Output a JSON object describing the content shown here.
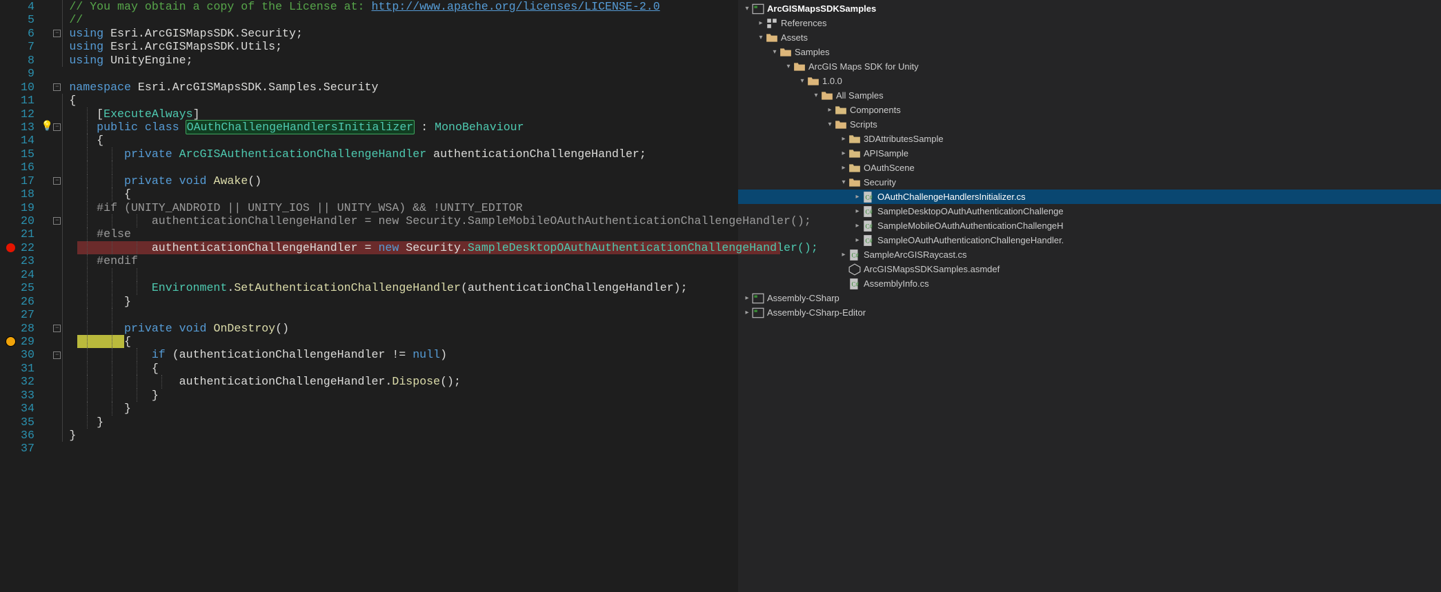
{
  "editor": {
    "lineNumbers": [
      "4",
      "5",
      "6",
      "7",
      "8",
      "9",
      "10",
      "11",
      "12",
      "13",
      "14",
      "15",
      "16",
      "17",
      "18",
      "19",
      "20",
      "21",
      "22",
      "23",
      "24",
      "25",
      "26",
      "27",
      "28",
      "29",
      "30",
      "31",
      "32",
      "33",
      "34",
      "35",
      "36",
      "37"
    ],
    "breakpoints": {
      "22": "red",
      "29": "orange"
    },
    "bulbLine": "13",
    "foldBoxes": {
      "6": "-",
      "10": "-",
      "13": "-",
      "17": "-",
      "20": "-",
      "28": "-",
      "30": "-"
    },
    "highlightedClass": "OAuthChallengeHandlersInitializer",
    "tokens": {
      "comment_license": "// You may obtain a copy of the License at: ",
      "license_url": "http://www.apache.org/licenses/LICENSE-2.0",
      "comment_slash": "//",
      "using": "using",
      "ns_security": "Esri.ArcGISMapsSDK.Security;",
      "ns_utils": "Esri.ArcGISMapsSDK.Utils;",
      "ns_unity": "UnityEngine;",
      "namespace": "namespace",
      "ns_full": "Esri.ArcGISMapsSDK.Samples.Security",
      "brace_open": "{",
      "brace_close": "}",
      "attr_open": "[",
      "attr_close": "]",
      "ExecuteAlways": "ExecuteAlways",
      "public": "public",
      "class": "class",
      "colon": " : ",
      "MonoBehaviour": "MonoBehaviour",
      "private": "private",
      "ArcGISAuthChallengeHandler": "ArcGISAuthenticationChallengeHandler",
      "field_name": "authenticationChallengeHandler;",
      "void": "void",
      "Awake": "Awake",
      "parens": "()",
      "pre_if": "#if (UNITY_ANDROID || UNITY_IOS || UNITY_WSA) && !UNITY_EDITOR",
      "pre_else": "#else",
      "pre_endif": "#endif",
      "assign_mobile": "authenticationChallengeHandler = ",
      "new": "new",
      "sec_ns": "Security",
      "dot": ".",
      "mobile_ctor": "SampleMobileOAuthAuthenticationChallengeHandler();",
      "desktop_ctor": "SampleDesktopOAuthAuthenticationChallengeHandler();",
      "Environment": "Environment",
      "SetAuth": "SetAuthenticationChallengeHandler",
      "arg": "(authenticationChallengeHandler);",
      "OnDestroy": "OnDestroy",
      "if": "if",
      "cond": " (authenticationChallengeHandler != ",
      "null": "null",
      "cond_close": ")",
      "dispose": "authenticationChallengeHandler.",
      "DisposeM": "Dispose",
      "dispose_end": "();"
    }
  },
  "solution": {
    "project": "ArcGISMapsSDKSamples",
    "nodes": {
      "references": "References",
      "assets": "Assets",
      "samples": "Samples",
      "sdk": "ArcGIS Maps SDK for Unity",
      "ver": "1.0.0",
      "allsamples": "All Samples",
      "components": "Components",
      "scripts": "Scripts",
      "attr3d": "3DAttributesSample",
      "apisample": "APISample",
      "oauthscene": "OAuthScene",
      "security": "Security",
      "file_init": "OAuthChallengeHandlersInitializer.cs",
      "file_desktop": "SampleDesktopOAuthAuthenticationChallenge",
      "file_mobile": "SampleMobileOAuthAuthenticationChallengeH",
      "file_sample": "SampleOAuthAuthenticationChallengeHandler.",
      "file_raycast": "SampleArcGISRaycast.cs",
      "file_asmdef": "ArcGISMapsSDKSamples.asmdef",
      "file_asminfo": "AssemblyInfo.cs",
      "asm_csharp": "Assembly-CSharp",
      "asm_csharp_ed": "Assembly-CSharp-Editor"
    }
  }
}
